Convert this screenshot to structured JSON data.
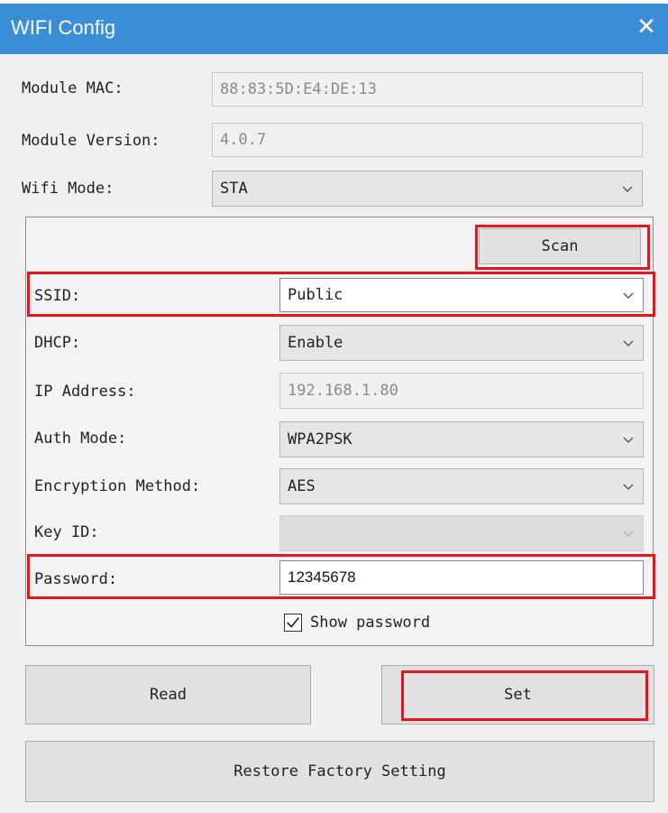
{
  "window": {
    "title": "WIFI Config"
  },
  "module_mac": {
    "label": "Module MAC:",
    "value": "88:83:5D:E4:DE:13"
  },
  "module_version": {
    "label": "Module Version:",
    "value": "4.0.7"
  },
  "wifi_mode": {
    "label": "Wifi Mode:",
    "value": "STA"
  },
  "scan_button": {
    "label": "Scan"
  },
  "ssid": {
    "label": "SSID:",
    "value": "Public"
  },
  "dhcp": {
    "label": "DHCP:",
    "value": "Enable"
  },
  "ip_address": {
    "label": "IP Address:",
    "value": "192.168.1.80"
  },
  "auth_mode": {
    "label": "Auth Mode:",
    "value": "WPA2PSK"
  },
  "encryption_method": {
    "label": "Encryption Method:",
    "value": "AES"
  },
  "key_id": {
    "label": "Key ID:",
    "value": ""
  },
  "password": {
    "label": "Password:",
    "value": "12345678"
  },
  "show_password": {
    "label": "Show password",
    "checked": true
  },
  "buttons": {
    "read": "Read",
    "set": "Set",
    "restore": "Restore Factory Setting"
  },
  "colors": {
    "titlebar": "#3a8ed6",
    "highlight": "#e8141c"
  }
}
